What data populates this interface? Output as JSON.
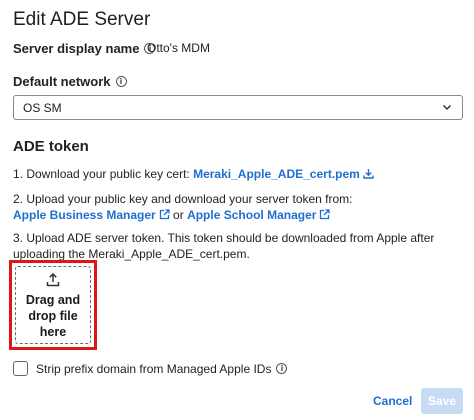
{
  "dialog": {
    "title": "Edit ADE Server"
  },
  "server": {
    "label": "Server display name",
    "value": "Otto's MDM"
  },
  "network": {
    "label": "Default network",
    "selected": "OS SM"
  },
  "ade": {
    "section_title": "ADE token",
    "step1_text": "1. Download your public key cert: ",
    "step1_link": "Meraki_Apple_ADE_cert.pem",
    "step2_text": "2. Upload your public key and download your server token from:",
    "step2_link1": "Apple Business Manager",
    "step2_or": " or ",
    "step2_link2": "Apple School Manager",
    "step3_text": "3. Upload ADE server token. This token should be downloaded from Apple after uploading the Meraki_Apple_ADE_cert.pem."
  },
  "dropzone": {
    "text": "Drag and drop file here"
  },
  "strip_prefix": {
    "label": "Strip prefix domain from Managed Apple IDs",
    "checked": false
  },
  "footer": {
    "cancel_label": "Cancel",
    "save_label": "Save"
  },
  "colors": {
    "link": "#1f6fd1",
    "highlight": "#e0151c",
    "save_disabled": "#c8dbf5"
  }
}
